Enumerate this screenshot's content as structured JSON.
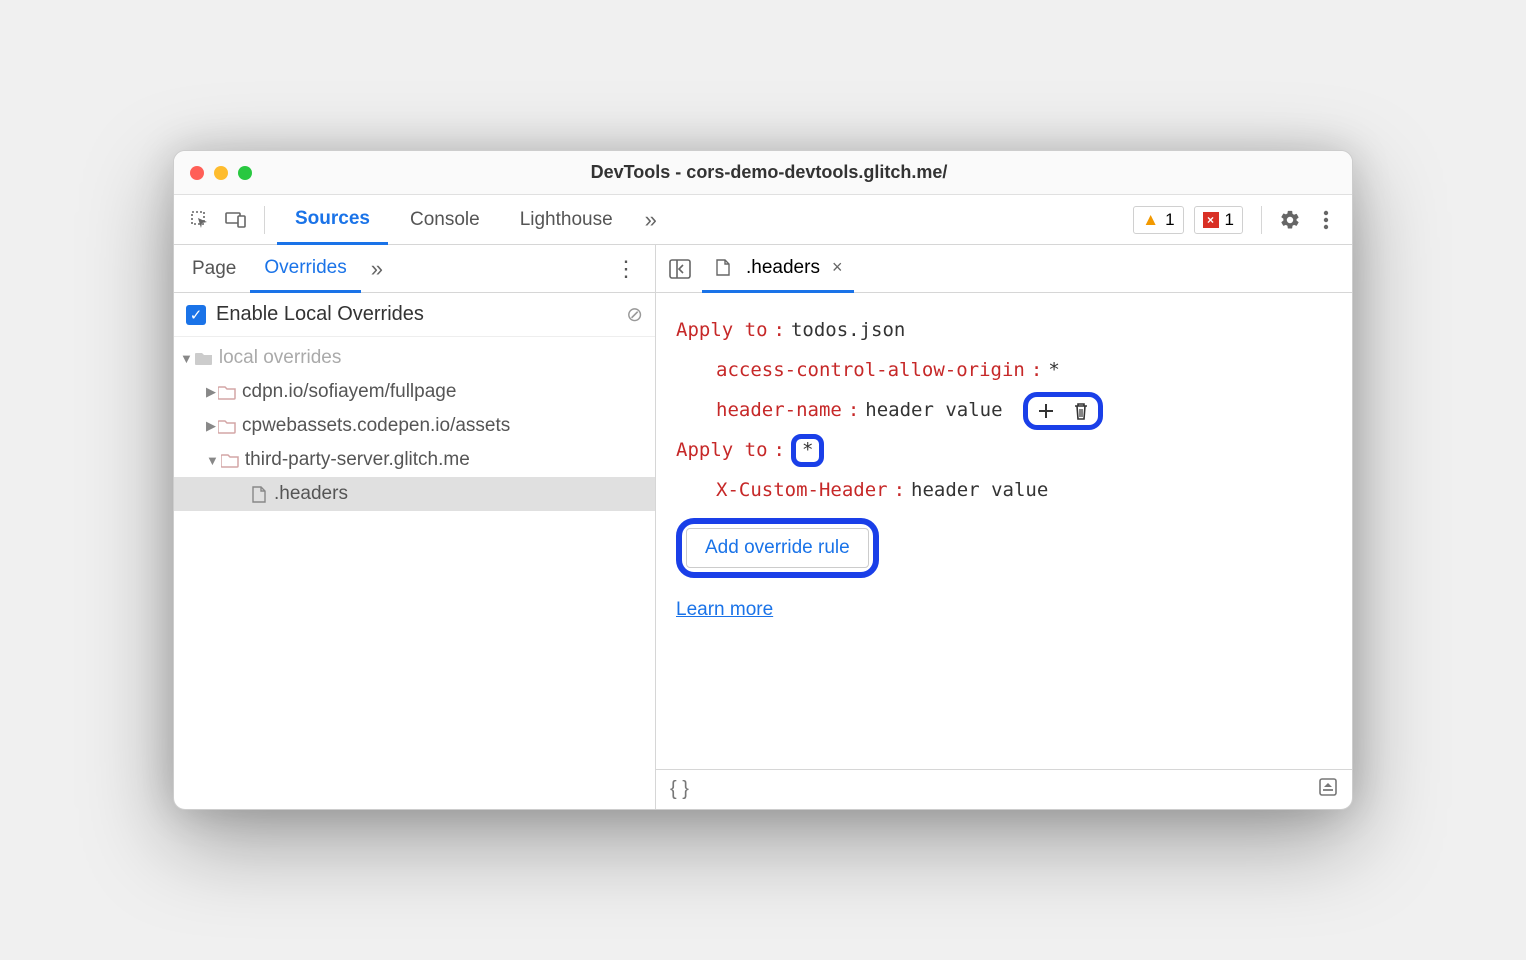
{
  "window": {
    "title": "DevTools - cors-demo-devtools.glitch.me/"
  },
  "toolbar": {
    "tabs": [
      "Sources",
      "Console",
      "Lighthouse"
    ],
    "active_tab": "Sources",
    "warning_count": "1",
    "error_count": "1"
  },
  "sidebar": {
    "tabs": [
      "Page",
      "Overrides"
    ],
    "active_tab": "Overrides",
    "enable_label": "Enable Local Overrides",
    "tree": {
      "root": "local overrides",
      "folders": [
        "cdpn.io/sofiayem/fullpage",
        "cpwebassets.codepen.io/assets",
        "third-party-server.glitch.me"
      ],
      "file": ".headers"
    }
  },
  "editor": {
    "tab_label": ".headers",
    "rules": [
      {
        "apply_label": "Apply to",
        "apply_value": "todos.json",
        "headers": [
          {
            "key": "access-control-allow-origin",
            "value": "*"
          },
          {
            "key": "header-name",
            "value": "header value"
          }
        ]
      },
      {
        "apply_label": "Apply to",
        "apply_value": "*",
        "headers": [
          {
            "key": "X-Custom-Header",
            "value": "header value"
          }
        ]
      }
    ],
    "add_rule_label": "Add override rule",
    "learn_more": "Learn more"
  }
}
